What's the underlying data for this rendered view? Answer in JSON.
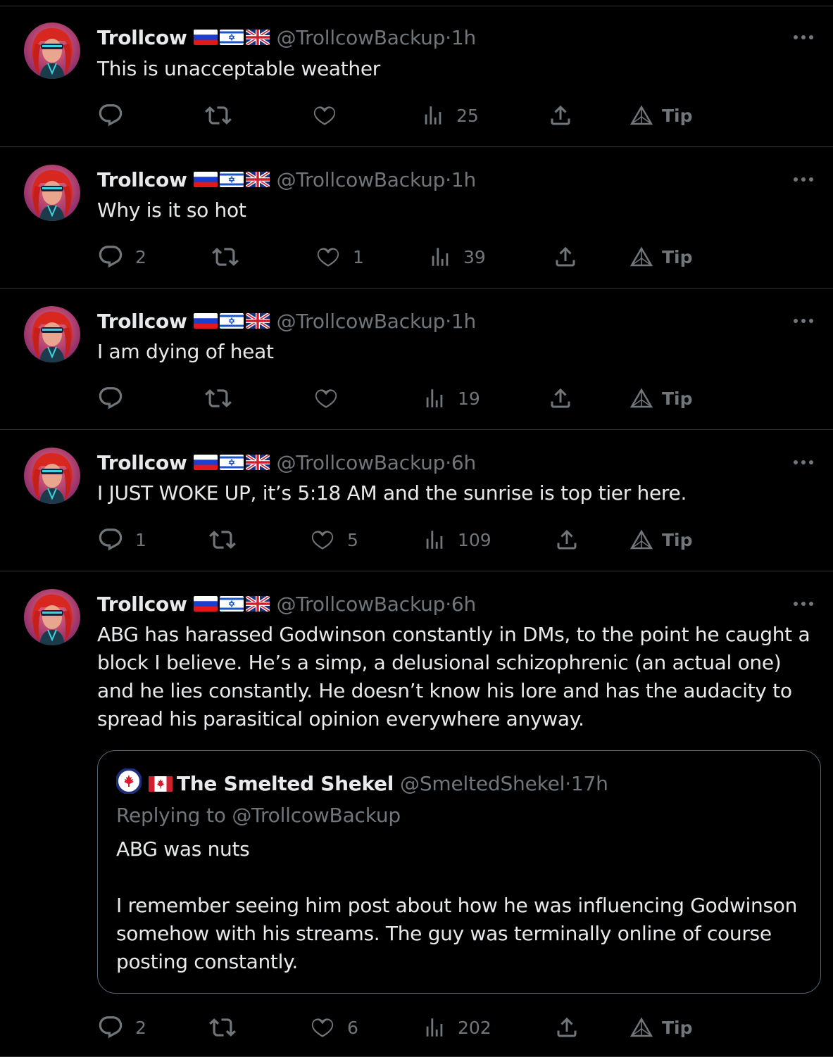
{
  "author": {
    "name": "Trollcow",
    "handle": "@TrollcowBackup",
    "flags": [
      "russia-flag-icon",
      "israel-flag-icon",
      "uk-flag-icon"
    ]
  },
  "tweets": [
    {
      "time": "1h",
      "text": "This is unacceptable weather",
      "replies": "",
      "retweets": "",
      "likes": "",
      "views": "25",
      "tip": "Tip"
    },
    {
      "time": "1h",
      "text": "Why is it so hot",
      "replies": "2",
      "retweets": "",
      "likes": "1",
      "views": "39",
      "tip": "Tip"
    },
    {
      "time": "1h",
      "text": "I am dying of heat",
      "replies": "",
      "retweets": "",
      "likes": "",
      "views": "19",
      "tip": "Tip"
    },
    {
      "time": "6h",
      "text": "I JUST WOKE UP, it’s 5:18 AM and the sunrise is top tier here.",
      "replies": "1",
      "retweets": "",
      "likes": "5",
      "views": "109",
      "tip": "Tip"
    },
    {
      "time": "6h",
      "text": "ABG has harassed Godwinson constantly in DMs, to the point he caught a block I believe. He’s a simp, a delusional schizophrenic (an actual one) and he lies constantly. He doesn’t know his lore and has the audacity to spread his parasitical opinion everywhere anyway.",
      "replies": "2",
      "retweets": "",
      "likes": "6",
      "views": "202",
      "tip": "Tip",
      "quote": {
        "name": "The Smelted Shekel",
        "handle": "@SmeltedShekel",
        "time": "17h",
        "replying": "Replying to @TrollcowBackup",
        "text": "ABG was nuts\n\nI remember seeing him post about how he was influencing Godwinson somehow with his streams. The guy was terminally online of course posting constantly."
      }
    }
  ],
  "meta_separator": " · ",
  "colors": {
    "background": "#000000",
    "text": "#e7e9ea",
    "muted": "#71767b",
    "divider": "#2f3336"
  }
}
